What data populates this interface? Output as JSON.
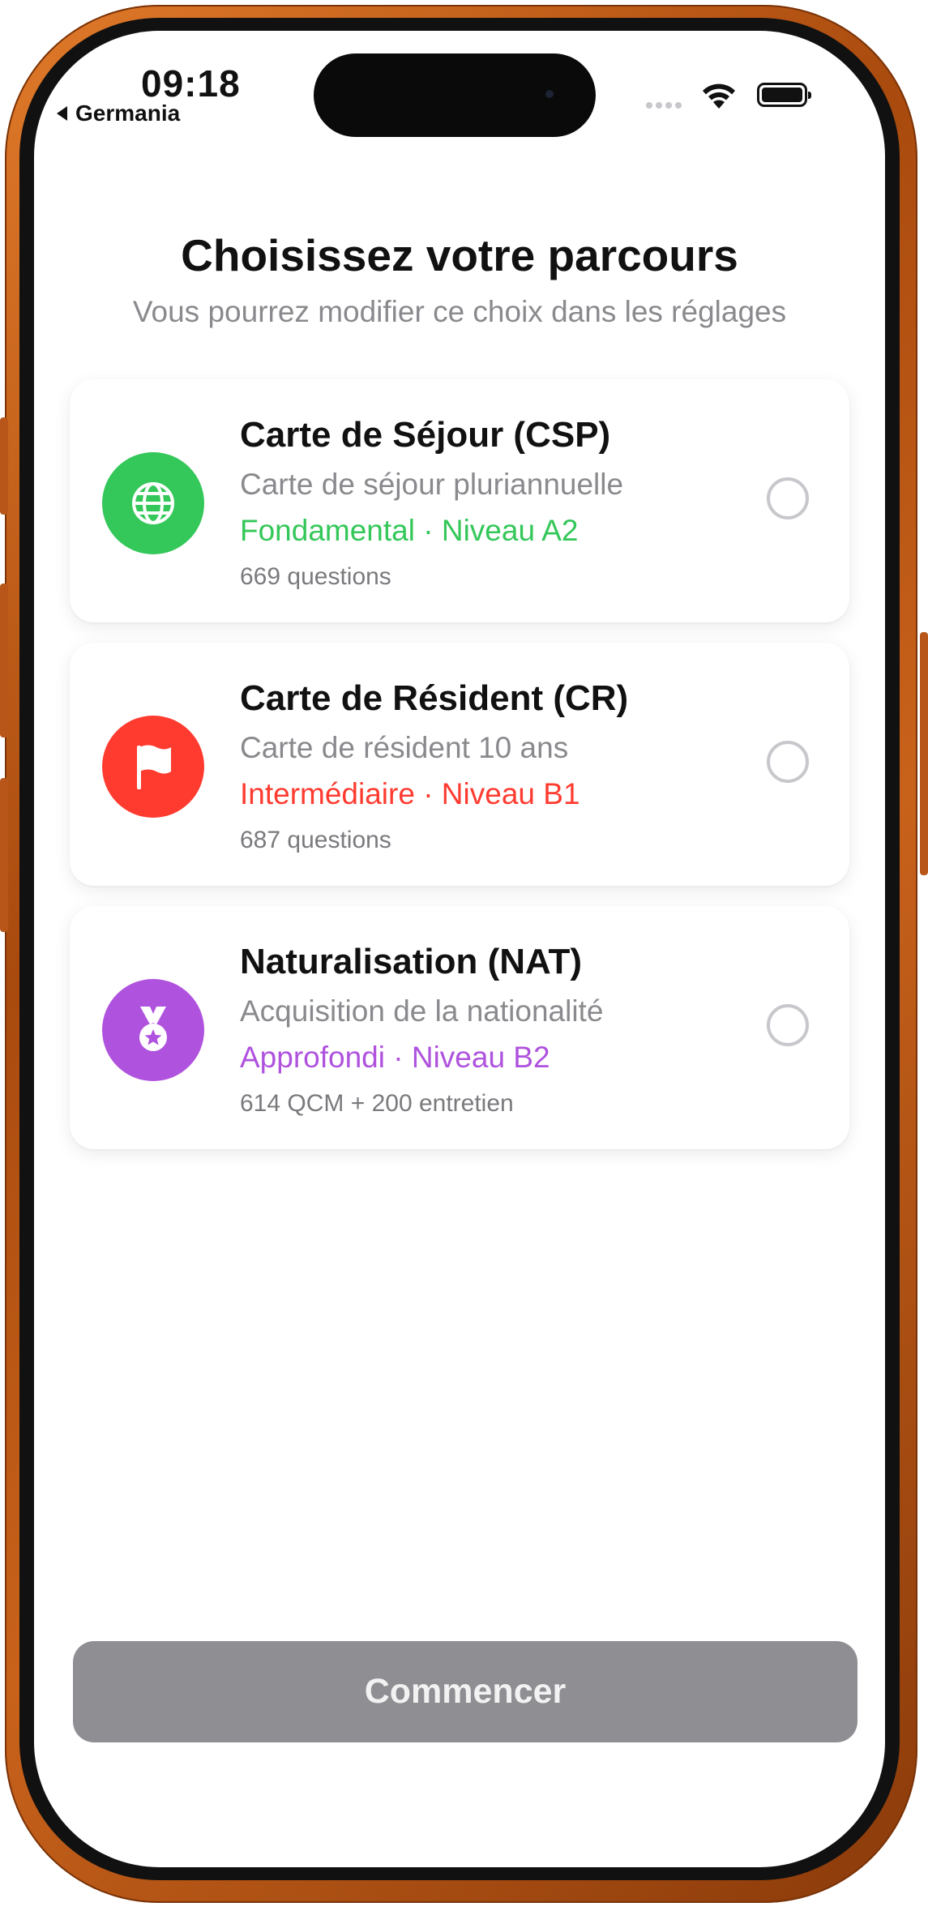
{
  "status_bar": {
    "time": "09:18",
    "back_label": "Germania"
  },
  "header": {
    "title": "Choisissez votre parcours",
    "subtitle": "Vous pourrez modifier ce choix dans les réglages"
  },
  "options": [
    {
      "name": "Carte de Séjour (CSP)",
      "description": "Carte de séjour pluriannuelle",
      "level": "Fondamental · Niveau A2",
      "count": "669 questions",
      "color": "#34c759",
      "icon": "globe-icon"
    },
    {
      "name": "Carte de Résident (CR)",
      "description": "Carte de résident 10 ans",
      "level": "Intermédiaire · Niveau B1",
      "count": "687 questions",
      "color": "#ff3b30",
      "icon": "flag-icon"
    },
    {
      "name": "Naturalisation (NAT)",
      "description": "Acquisition de la nationalité",
      "level": "Approfondi · Niveau B2",
      "count": "614 QCM + 200 entretien",
      "color": "#af52de",
      "icon": "medal-icon"
    }
  ],
  "footer": {
    "start_label": "Commencer",
    "button_color": "#8e8e93"
  }
}
